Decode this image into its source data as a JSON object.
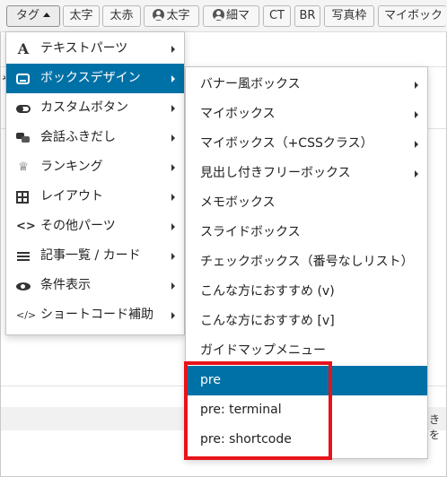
{
  "toolbar": {
    "buttons": [
      {
        "label": "タグ",
        "has_caret": true
      },
      {
        "label": "太字"
      },
      {
        "label": "太赤"
      },
      {
        "label": "太字",
        "icon": "user-icon"
      },
      {
        "label": "細マ",
        "icon": "user-icon"
      },
      {
        "label": "CT"
      },
      {
        "label": "BR"
      },
      {
        "label": "写真枠"
      },
      {
        "label": "マイボック"
      }
    ]
  },
  "background": {
    "left_fragment": "や",
    "right_fragment": "きを"
  },
  "menu": {
    "items": [
      {
        "label": "テキストパーツ",
        "icon": "letter-a-icon"
      },
      {
        "label": "ボックスデザイン",
        "icon": "inbox-icon",
        "selected": true
      },
      {
        "label": "カスタムボタン",
        "icon": "toggle-icon"
      },
      {
        "label": "会話ふきだし",
        "icon": "chat-bubbles-icon"
      },
      {
        "label": "ランキング",
        "icon": "crown-icon"
      },
      {
        "label": "レイアウト",
        "icon": "grid-icon"
      },
      {
        "label": "その他パーツ",
        "icon": "code-icon"
      },
      {
        "label": "記事一覧 / カード",
        "icon": "list-icon"
      },
      {
        "label": "条件表示",
        "icon": "eye-icon"
      },
      {
        "label": "ショートコード補助",
        "icon": "shortcode-icon"
      }
    ]
  },
  "submenu": {
    "items": [
      {
        "label": "バナー風ボックス",
        "has_arrow": true
      },
      {
        "label": "マイボックス",
        "has_arrow": true
      },
      {
        "label": "マイボックス（+CSSクラス）",
        "has_arrow": true
      },
      {
        "label": "見出し付きフリーボックス",
        "has_arrow": true
      },
      {
        "label": "メモボックス"
      },
      {
        "label": "スライドボックス"
      },
      {
        "label": "チェックボックス（番号なしリスト）"
      },
      {
        "label": "こんな方におすすめ (v)"
      },
      {
        "label": "こんな方におすすめ [v]"
      },
      {
        "label": "ガイドマップメニュー"
      },
      {
        "label": "pre",
        "selected": true
      },
      {
        "label": "pre: terminal"
      },
      {
        "label": "pre: shortcode"
      }
    ]
  },
  "colors": {
    "selected_bg": "#0071a6",
    "highlight": "#e8131a"
  }
}
